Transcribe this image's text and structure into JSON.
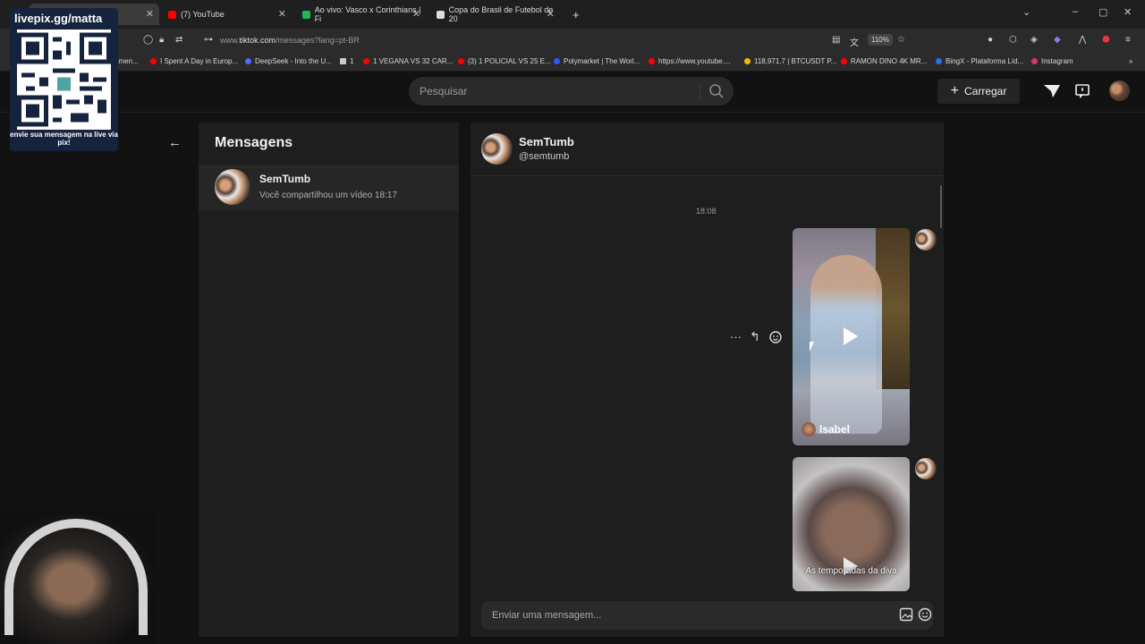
{
  "browser": {
    "tabs": [
      {
        "label": "",
        "favicon_color": "#555555",
        "active": true
      },
      {
        "label": "(7) YouTube",
        "favicon_color": "#ff0000"
      },
      {
        "label": "Ao vivo: Vasco x Corinthians | Fi",
        "favicon_color": "#1db954"
      },
      {
        "label": "Copa do Brasil de Futebol de 20",
        "favicon_color": "#dddddd"
      }
    ],
    "new_tab": "+",
    "url_prefix": "www.",
    "url_domain": "tiktok.com",
    "url_path": "/messages?lang=pt-BR",
    "zoom": "110%",
    "window_controls": [
      "–",
      "▢",
      "✕"
    ],
    "bookmarks": [
      {
        "label": "amen...",
        "color": "#4a7ddc"
      },
      {
        "label": "I Spent A Day in Europ...",
        "color": "#ff0000"
      },
      {
        "label": "DeepSeek - Into the U...",
        "color": "#4d6bfe"
      },
      {
        "label": "1",
        "color": "#cccccc"
      },
      {
        "label": "1 VEGANA VS 32 CAR...",
        "color": "#ff0000"
      },
      {
        "label": "(3) 1 POLICIAL VS 25 E...",
        "color": "#ff0000"
      },
      {
        "label": "Polymarket | The Worl...",
        "color": "#2d5bff"
      },
      {
        "label": "https://www.youtube....",
        "color": "#ff0000"
      },
      {
        "label": "118,971.7 | BTCUSDT P...",
        "color": "#f0b90b"
      },
      {
        "label": "RAMON DINO 4K MR...",
        "color": "#ff0000"
      },
      {
        "label": "BingX - Plataforma Líd...",
        "color": "#2b6cf0"
      },
      {
        "label": "Instagram",
        "color": "#e1306c"
      }
    ]
  },
  "header": {
    "search_placeholder": "Pesquisar",
    "upload_label": "Carregar"
  },
  "left_panel": {
    "title": "Mensagens",
    "conversations": [
      {
        "name": "SemTumb",
        "preview": "Você compartilhou um vídeo",
        "time": "18:17"
      }
    ]
  },
  "chat": {
    "name": "SemTumb",
    "handle": "@semtumb",
    "timestamp": "18:08",
    "messages": [
      {
        "type": "video",
        "author": "Isabel"
      },
      {
        "type": "video",
        "caption": "As temporadas da diva"
      }
    ],
    "composer_placeholder": "Enviar uma mensagem..."
  },
  "overlay": {
    "qr_title": "livepix.gg/matta",
    "qr_caption": "envie sua mensagem na live via pix!"
  }
}
